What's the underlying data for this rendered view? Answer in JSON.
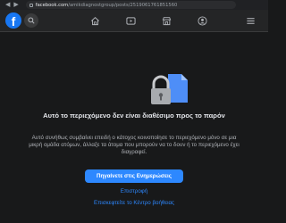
{
  "browser": {
    "url_host": "facebook.com",
    "url_path": "/amikdiagnostgroup/posts/2519061761851560"
  },
  "header": {
    "logo_letter": "f",
    "icons": [
      "home-icon",
      "video-icon",
      "marketplace-icon",
      "groups-icon",
      "menu-icon"
    ]
  },
  "content": {
    "headline": "Αυτό το περιεχόμενο δεν είναι διαθέσιμο προς το παρόν",
    "body": "Αυτό συνήθως συμβαίνει επειδή ο κάτοχος κοινοποίησε το περιεχόμενο μόνο σε μια μικρή ομάδα ατόμων, άλλαξε τα άτομα που μπορούν να το δουν ή το περιεχόμενο έχει διαγραφεί.",
    "primary_button": "Πηγαίνετε στις Ενημερώσεις",
    "back_link": "Επιστροφή",
    "help_link": "Επισκεφτείτε το Κέντρο βοήθειας"
  },
  "colors": {
    "background": "#18191a",
    "header": "#242526",
    "accent": "#2d88ff",
    "brand": "#1877f2"
  }
}
